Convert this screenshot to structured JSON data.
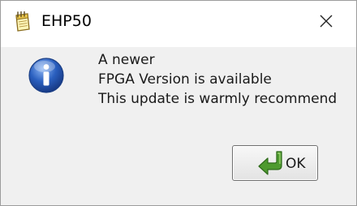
{
  "window": {
    "title": "EHP50",
    "close_symbol": "✕"
  },
  "message": {
    "lines": [
      "A newer",
      "FPGA Version is available",
      "This update is warmly recommend"
    ]
  },
  "buttons": {
    "ok_label": "OK"
  },
  "icons": {
    "app": "notepad-icon",
    "message": "information-icon",
    "ok": "green-return-arrow-icon"
  },
  "colors": {
    "titlebar": "#ffffff",
    "body": "#f0f0f0",
    "info_blue": "#2a5fbf",
    "ok_arrow_green": "#3d8a2a"
  }
}
